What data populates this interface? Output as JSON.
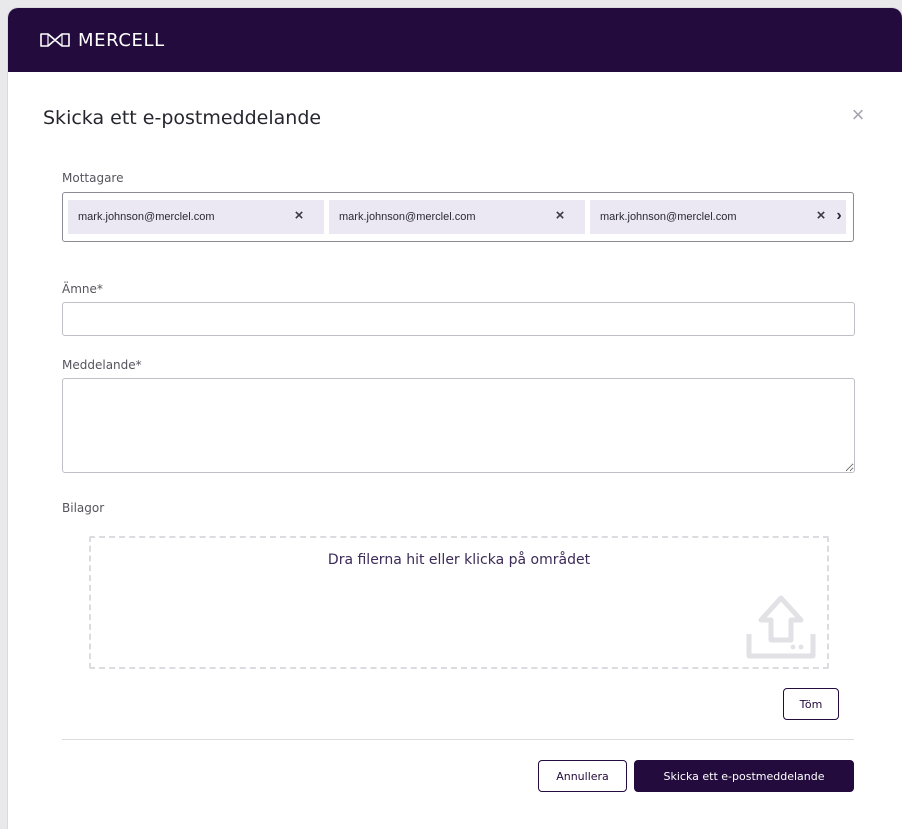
{
  "brand": {
    "name": "MERCELL",
    "logo_icon": "mercell-logo-icon"
  },
  "dialog": {
    "title": "Skicka ett e-postmeddelande",
    "close_icon": "close-icon"
  },
  "recipients": {
    "label": "Mottagare",
    "chips": [
      {
        "email": "mark.johnson@merclel.com"
      },
      {
        "email": "mark.johnson@merclel.com"
      },
      {
        "email": "mark.johnson@merclel.com"
      }
    ],
    "remove_icon": "remove-x-icon",
    "scroll_icon": "chevron-right-icon"
  },
  "subject": {
    "label": "Ämne*",
    "value": "",
    "placeholder": ""
  },
  "message": {
    "label": "Meddelande*",
    "value": "",
    "placeholder": ""
  },
  "attachments": {
    "label": "Bilagor",
    "dropzone_text": "Dra filerna hit eller klicka på området",
    "icon": "upload-icon",
    "clear_label": "Töm"
  },
  "footer": {
    "cancel_label": "Annullera",
    "send_label": "Skicka ett e-postmeddelande"
  },
  "colors": {
    "brand": "#230b3d",
    "chip_bg": "#ece8f3",
    "dropzone_border": "#dcdce0"
  }
}
